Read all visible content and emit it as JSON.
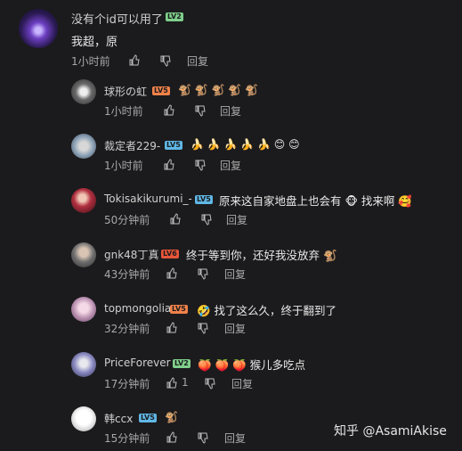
{
  "main": {
    "username": "没有个id可以用了",
    "level": "LV2",
    "text": "我超，原",
    "time": "1小时前",
    "reply": "回复"
  },
  "replies": [
    {
      "username": "球形の虹",
      "level": "LV5",
      "emoji": "🐒 🐒 🐒 🐒 🐒",
      "time": "1小时前",
      "reply": "回复"
    },
    {
      "username": "裁定者229-",
      "level": "LV5",
      "emoji": "🍌 🍌 🍌 🍌 🍌 😊 😊",
      "time": "1小时前",
      "reply": "回复"
    },
    {
      "username": "Tokisakikurumi_-",
      "level": "LV5",
      "text": "原来这自家地盘上也会有 🐵 找来啊 🥰",
      "time": "50分钟前",
      "reply": "回复"
    },
    {
      "username": "gnk48丁真",
      "level": "LV6",
      "text": "终于等到你，还好我没放弃 🐒",
      "time": "43分钟前",
      "reply": "回复"
    },
    {
      "username": "topmongolia",
      "level": "LV5",
      "text": "🤣 找了这么久，终于翻到了",
      "time": "32分钟前",
      "reply": "回复"
    },
    {
      "username": "PriceForever",
      "level": "LV2",
      "text": "🍑 🍑 🍑 猴儿多吃点",
      "time": "17分钟前",
      "likes": "1",
      "reply": "回复"
    },
    {
      "username": "韩ccx",
      "level": "LV5",
      "emoji": "🐒",
      "time": "15分钟前",
      "reply": "回复"
    }
  ],
  "watermark": "知乎 @AsamiAkise",
  "colors": {
    "background": "#1b1b1d",
    "text": "#e8e8e8",
    "muted": "#a8a8a8"
  }
}
